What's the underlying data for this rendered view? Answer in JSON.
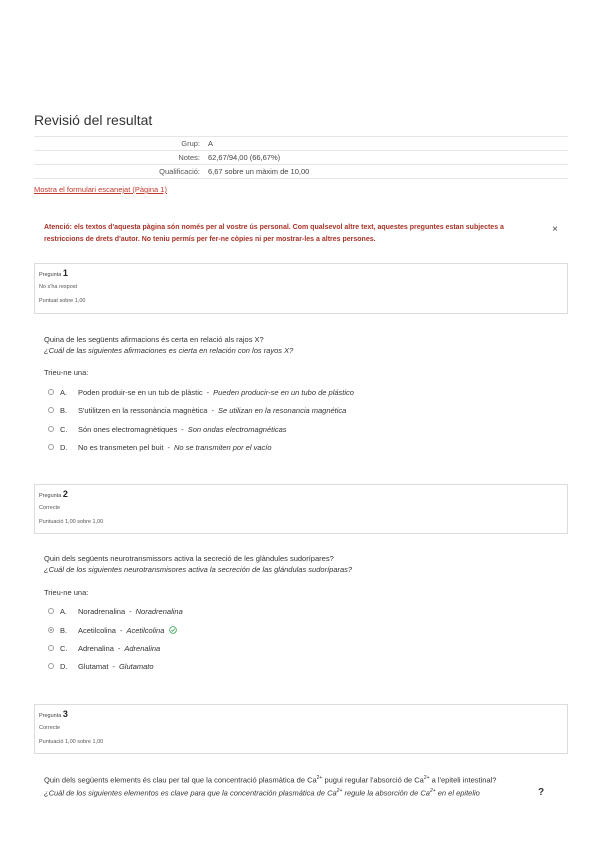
{
  "page_title": "Revisió del resultat",
  "summary": {
    "group_label": "Grup:",
    "group_value": "A",
    "notes_label": "Notes:",
    "notes_value": "62,67/94,00 (66,67%)",
    "grade_label": "Qualificació:",
    "grade_value": "6,67 sobre un màxim de 10,00"
  },
  "scan_link": "Mostra el formulari escanejat (Pàgina 1)",
  "alert": {
    "text": "Atenció: els textos d'aquesta pàgina són només per al vostre ús personal. Com qualsevol altre text, aquestes preguntes estan subjectes a restriccions de drets d'autor. No teniu permís per fer-ne còpies ni per mostrar-les a altres persones.",
    "close": "×"
  },
  "questions": [
    {
      "word": "Pregunta",
      "number": "1",
      "status": "No s'ha respost",
      "score": "Puntuat sobre 1,00",
      "text_ca": "Quina de les següents afirmacions és certa en relació als rajos X?",
      "text_es": "¿Cuál de las siguientes afirmaciones es cierta en relación con los rayos X?",
      "choose": "Trieu-ne una:",
      "options": [
        {
          "letter": "A.",
          "ca": "Poden produir-se en un tub de plàstic",
          "es": "Pueden producir-se en un tubo de plástico"
        },
        {
          "letter": "B.",
          "ca": "S'utilitzen en la ressonància magnètica",
          "es": "Se utilizan en la resonancia magnética"
        },
        {
          "letter": "C.",
          "ca": "Són ones electromagnètiques",
          "es": "Son ondas electromagnéticas"
        },
        {
          "letter": "D.",
          "ca": "No es transmeten pel buit",
          "es": "No se transmiten por el vacío"
        }
      ]
    },
    {
      "word": "Pregunta",
      "number": "2",
      "status": "Correcte",
      "score": "Puntuació 1,00 sobre 1,00",
      "text_ca": "Quin dels següents neurotransmissors activa la secreció de les glàndules sudorípares?",
      "text_es": "¿Cuál de los siguientes neurotransmisores activa la secreción de las glándulas sudoríparas?",
      "choose": "Trieu-ne una:",
      "options": [
        {
          "letter": "A.",
          "ca": "Noradrenalina",
          "es": "Noradrenalina"
        },
        {
          "letter": "B.",
          "ca": "Acetilcolina",
          "es": "Acetilcolina"
        },
        {
          "letter": "C.",
          "ca": "Adrenalina",
          "es": "Adrenalina"
        },
        {
          "letter": "D.",
          "ca": "Glutamat",
          "es": "Glutamato"
        }
      ],
      "selected_option": "B.",
      "correct_icon": "check-circle-icon"
    },
    {
      "word": "Pregunta",
      "number": "3",
      "status": "Correcte",
      "score": "Puntuació 1,00 sobre 1,00",
      "text_ca_1": "Quin dels següents elements és clau per tal que la concentració plasmàtica de Ca",
      "text_ca_2": " pugui regular l'absorció de Ca",
      "text_ca_3": " a l'epiteli intestinal?",
      "text_es_1": "¿Cuál de los siguientes elementos es clave para que la concentración plasmática de Ca",
      "text_es_2": " regule la absorción de Ca",
      "text_es_3": " en el epitelio",
      "superscript": "2+"
    }
  ],
  "sep": "-",
  "help": "?",
  "colors": {
    "accent": "#c0392b",
    "alert_text": "#a93226",
    "success": "#2e9e4f",
    "border": "#dcdcdc"
  }
}
